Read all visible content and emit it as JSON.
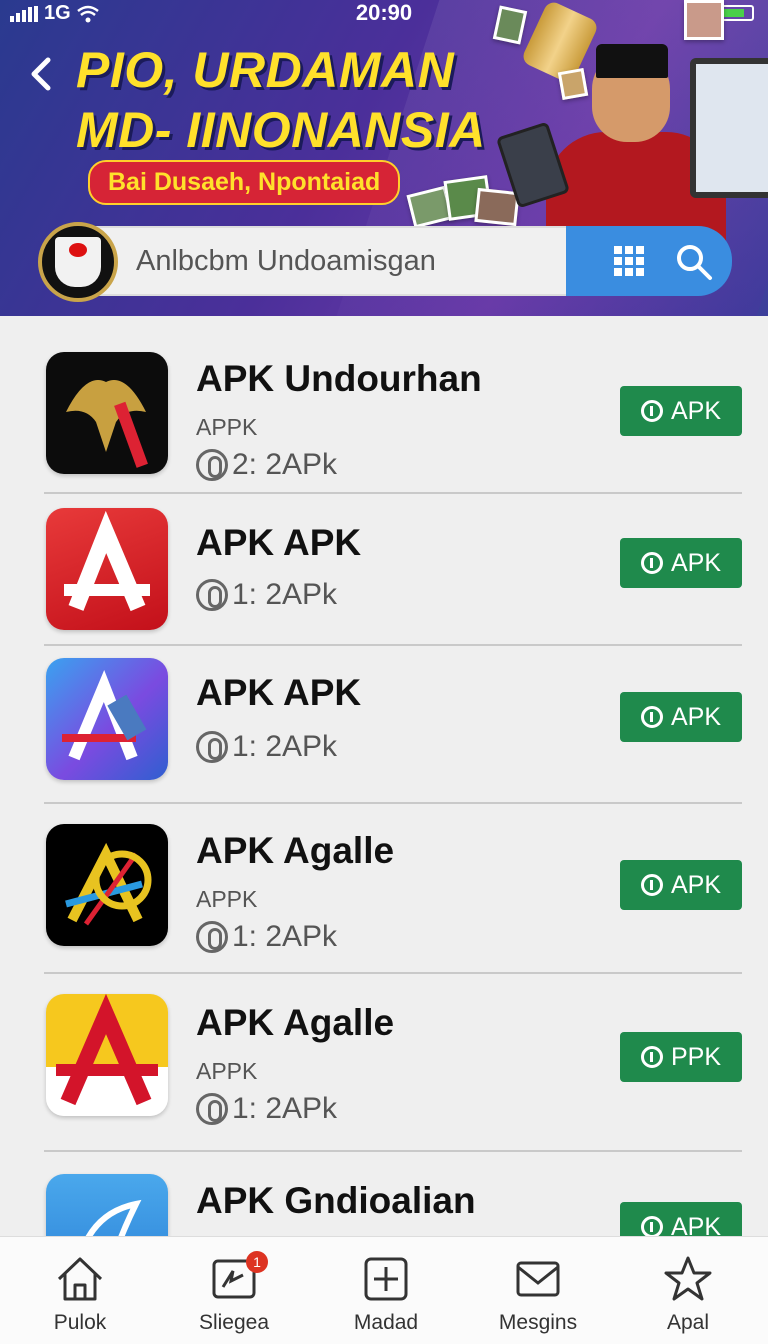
{
  "status_bar": {
    "network": "1G",
    "time": "20:90"
  },
  "banner": {
    "title_line1": "PIO, URDAMAN",
    "title_line2": "MD- IINONANSIA",
    "subtitle": "Bai Dusaeh, Npontaiad"
  },
  "search": {
    "placeholder": "Anlbcbm Undoamisgan"
  },
  "apps": [
    {
      "name": "APK Undourhan",
      "sub": "APPK",
      "meta": "2: 2APk",
      "button": "APK"
    },
    {
      "name": "APK APK",
      "sub": "",
      "meta": "1: 2APk",
      "button": "APK"
    },
    {
      "name": "APK APK",
      "sub": "",
      "meta": "1: 2APk",
      "button": "APK"
    },
    {
      "name": "APK  Agalle",
      "sub": "APPK",
      "meta": "1: 2APk",
      "button": "APK"
    },
    {
      "name": "APK Agalle",
      "sub": "APPK",
      "meta": "1: 2APk",
      "button": "PPK"
    },
    {
      "name": "APK Gndioalian",
      "sub": "",
      "meta": "",
      "button": "APK"
    }
  ],
  "nav": [
    {
      "label": "Pulok",
      "icon": "home-icon"
    },
    {
      "label": "Sliegea",
      "icon": "news-icon",
      "badge": "1"
    },
    {
      "label": "Madad",
      "icon": "plus-box-icon"
    },
    {
      "label": "Mesgins",
      "icon": "mail-icon"
    },
    {
      "label": "Apal",
      "icon": "star-icon"
    }
  ],
  "colors": {
    "accent_green": "#1f8a4c",
    "header_purple": "#4b2f9a",
    "search_blue": "#3a8de0",
    "title_yellow": "#ffe12b"
  }
}
